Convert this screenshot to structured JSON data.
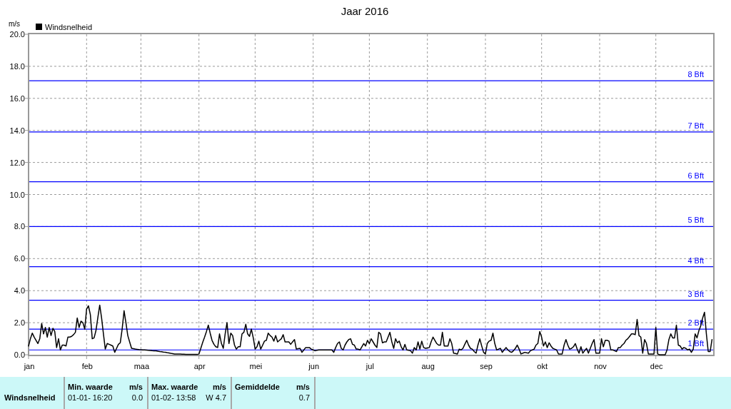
{
  "chart": {
    "chart_data": {
      "type": "line",
      "title": "Jaar 2016",
      "ylabel": "m/s",
      "grid": true,
      "categories": [
        "jan",
        null,
        null,
        null,
        null,
        null,
        null,
        null,
        null,
        null,
        null,
        null,
        null,
        null,
        null,
        null,
        null,
        null,
        null,
        null,
        null,
        null,
        null,
        null,
        null,
        null,
        null,
        null,
        null,
        null,
        null,
        "feb",
        null,
        null,
        null,
        null,
        null,
        null,
        null,
        null,
        null,
        null,
        null,
        null,
        null,
        null,
        null,
        null,
        null,
        null,
        null,
        null,
        null,
        null,
        null,
        null,
        null,
        null,
        null,
        null,
        "maa",
        null,
        null,
        null,
        null,
        null,
        null,
        null,
        null,
        null,
        null,
        null,
        null,
        null,
        null,
        null,
        null,
        null,
        null,
        null,
        null,
        null,
        null,
        null,
        null,
        null,
        null,
        null,
        null,
        null,
        null,
        "apr",
        null,
        null,
        null,
        null,
        null,
        null,
        null,
        null,
        null,
        null,
        null,
        null,
        null,
        null,
        null,
        null,
        null,
        null,
        null,
        null,
        null,
        null,
        null,
        null,
        null,
        null,
        null,
        null,
        null,
        "mei",
        null,
        null,
        null,
        null,
        null,
        null,
        null,
        null,
        null,
        null,
        null,
        null,
        null,
        null,
        null,
        null,
        null,
        null,
        null,
        null,
        null,
        null,
        null,
        null,
        null,
        null,
        null,
        null,
        null,
        null,
        "jun",
        null,
        null,
        null,
        null,
        null,
        null,
        null,
        null,
        null,
        null,
        null,
        null,
        null,
        null,
        null,
        null,
        null,
        null,
        null,
        null,
        null,
        null,
        null,
        null,
        null,
        null,
        null,
        null,
        null,
        "jul",
        null,
        null,
        null,
        null,
        null,
        null,
        null,
        null,
        null,
        null,
        null,
        null,
        null,
        null,
        null,
        null,
        null,
        null,
        null,
        null,
        null,
        null,
        null,
        null,
        null,
        null,
        null,
        null,
        null,
        null,
        "aug",
        null,
        null,
        null,
        null,
        null,
        null,
        null,
        null,
        null,
        null,
        null,
        null,
        null,
        null,
        null,
        null,
        null,
        null,
        null,
        null,
        null,
        null,
        null,
        null,
        null,
        null,
        null,
        null,
        null,
        null,
        "sep",
        null,
        null,
        null,
        null,
        null,
        null,
        null,
        null,
        null,
        null,
        null,
        null,
        null,
        null,
        null,
        null,
        null,
        null,
        null,
        null,
        null,
        null,
        null,
        null,
        null,
        null,
        null,
        null,
        null,
        "okt",
        null,
        null,
        null,
        null,
        null,
        null,
        null,
        null,
        null,
        null,
        null,
        null,
        null,
        null,
        null,
        null,
        null,
        null,
        null,
        null,
        null,
        null,
        null,
        null,
        null,
        null,
        null,
        null,
        null,
        null,
        "nov",
        null,
        null,
        null,
        null,
        null,
        null,
        null,
        null,
        null,
        null,
        null,
        null,
        null,
        null,
        null,
        null,
        null,
        null,
        null,
        null,
        null,
        null,
        null,
        null,
        null,
        null,
        null,
        null,
        null,
        "dec",
        null,
        null,
        null,
        null,
        null,
        null,
        null,
        null,
        null,
        null,
        null,
        null,
        null,
        null,
        null,
        null,
        null,
        null,
        null,
        null,
        null,
        null,
        null,
        null,
        null,
        null,
        null,
        null,
        null,
        null
      ],
      "series": [
        {
          "name": "Windsnelheid",
          "color": "#000000",
          "values": [
            0.55,
            1.0,
            1.35,
            1.1,
            0.9,
            0.7,
            1.0,
            1.95,
            1.3,
            1.7,
            1.1,
            1.7,
            1.2,
            1.65,
            1.45,
            0.45,
            1.0,
            0.3,
            0.6,
            0.6,
            0.55,
            1.1,
            1.1,
            1.15,
            1.25,
            1.4,
            2.3,
            1.7,
            2.1,
            2.0,
            1.6,
            2.85,
            3.05,
            2.5,
            1.0,
            1.05,
            1.5,
            2.3,
            3.1,
            2.3,
            1.3,
            0.35,
            0.7,
            0.65,
            0.6,
            0.55,
            0.15,
            0.4,
            0.65,
            0.75,
            1.6,
            2.75,
            2.0,
            1.2,
            0.8,
            0.4,
            0.38,
            0.35,
            0.34,
            0.32,
            0.31,
            0.3,
            0.3,
            0.29,
            0.28,
            0.27,
            0.26,
            0.25,
            0.24,
            0.22,
            0.2,
            0.19,
            0.17,
            0.15,
            0.13,
            0.11,
            0.09,
            0.07,
            0.05,
            0.05,
            0.04,
            0.04,
            0.03,
            0.03,
            0.02,
            0.02,
            0.02,
            0.02,
            0.02,
            0.02,
            0.02,
            0.05,
            0.4,
            0.77,
            1.1,
            1.45,
            1.85,
            1.35,
            0.9,
            0.65,
            0.5,
            0.45,
            1.3,
            0.7,
            0.4,
            1.3,
            2.0,
            0.7,
            1.35,
            1.2,
            0.6,
            0.35,
            0.5,
            0.5,
            1.3,
            1.4,
            1.9,
            1.3,
            1.15,
            1.6,
            1.05,
            0.35,
            0.5,
            0.85,
            0.35,
            0.6,
            0.85,
            0.9,
            1.35,
            1.2,
            1.1,
            0.85,
            1.2,
            0.8,
            0.9,
            1.0,
            1.25,
            0.8,
            0.8,
            0.8,
            0.65,
            0.8,
            0.95,
            0.35,
            0.38,
            0.4,
            0.15,
            0.3,
            0.45,
            0.45,
            0.45,
            0.35,
            0.3,
            0.25,
            0.28,
            0.3,
            0.3,
            0.3,
            0.3,
            0.3,
            0.3,
            0.3,
            0.3,
            0.15,
            0.45,
            0.7,
            0.8,
            0.4,
            0.3,
            0.6,
            0.8,
            0.95,
            1.0,
            0.65,
            0.6,
            0.35,
            0.35,
            0.3,
            0.5,
            0.7,
            0.55,
            0.9,
            0.7,
            1.0,
            0.8,
            0.6,
            0.45,
            1.4,
            1.3,
            0.75,
            0.8,
            0.8,
            1.1,
            1.4,
            0.8,
            0.4,
            1.0,
            0.75,
            0.85,
            0.5,
            0.3,
            0.65,
            0.3,
            0.28,
            0.25,
            0.1,
            0.45,
            0.3,
            0.8,
            0.35,
            0.85,
            0.45,
            0.4,
            0.42,
            0.45,
            0.8,
            1.1,
            0.9,
            0.7,
            0.6,
            0.6,
            1.4,
            0.55,
            0.55,
            0.55,
            1.0,
            0.7,
            0.1,
            0.08,
            0.05,
            0.35,
            0.3,
            0.4,
            0.65,
            0.9,
            0.6,
            0.4,
            0.35,
            0.2,
            0.1,
            0.6,
            1.0,
            0.55,
            0.15,
            0.05,
            0.7,
            0.85,
            0.9,
            1.35,
            0.7,
            0.3,
            0.35,
            0.4,
            0.15,
            0.3,
            0.45,
            0.3,
            0.2,
            0.15,
            0.25,
            0.4,
            0.6,
            0.35,
            0.05,
            0.1,
            0.15,
            0.12,
            0.1,
            0.25,
            0.3,
            0.35,
            0.6,
            0.7,
            1.45,
            1.1,
            0.55,
            0.8,
            0.45,
            0.75,
            0.55,
            0.4,
            0.35,
            0.3,
            0.05,
            0.05,
            0.05,
            0.6,
            0.95,
            0.6,
            0.35,
            0.4,
            0.5,
            0.7,
            0.35,
            0.1,
            0.5,
            0.1,
            0.25,
            0.4,
            0.1,
            0.4,
            0.7,
            0.95,
            0.1,
            0.1,
            0.1,
            1.0,
            0.5,
            0.9,
            0.9,
            0.85,
            0.3,
            0.3,
            0.25,
            0.2,
            0.45,
            0.45,
            0.6,
            0.7,
            0.9,
            1.0,
            1.15,
            1.3,
            1.3,
            1.25,
            2.2,
            1.2,
            1.1,
            0.1,
            0.95,
            0.7,
            0.05,
            0.05,
            0.05,
            0.05,
            1.7,
            0.05,
            0,
            0,
            0,
            0,
            0.3,
            0.95,
            1.3,
            1.05,
            1.05,
            1.85,
            0.6,
            0.55,
            0.35,
            0.45,
            0.4,
            0.3,
            0.35,
            0.15,
            0.35,
            1.3,
            1.05,
            1.5,
            1.8,
            2.3,
            2.65,
            1.3,
            0.2,
            0.2,
            0.95
          ]
        }
      ],
      "ylim": [
        0,
        20
      ],
      "yticks": [
        {
          "value": 0,
          "label": "0.0"
        },
        {
          "value": 2,
          "label": "2.0"
        },
        {
          "value": 4,
          "label": "4.0"
        },
        {
          "value": 6,
          "label": "6.0"
        },
        {
          "value": 8,
          "label": "8.0"
        },
        {
          "value": 10,
          "label": "10.0"
        },
        {
          "value": 12,
          "label": "12.0"
        },
        {
          "value": 14,
          "label": "14.0"
        },
        {
          "value": 16,
          "label": "16.0"
        },
        {
          "value": 18,
          "label": "18.0"
        },
        {
          "value": 20,
          "label": "20.0"
        }
      ],
      "ref_lines": [
        {
          "axis": "y",
          "value": 17.1,
          "label": "8 Bft"
        },
        {
          "axis": "y",
          "value": 13.9,
          "label": "7 Bft"
        },
        {
          "axis": "y",
          "value": 10.8,
          "label": "6 Bft"
        },
        {
          "axis": "y",
          "value": 8.0,
          "label": "5 Bft"
        },
        {
          "axis": "y",
          "value": 5.5,
          "label": "4 Bft"
        },
        {
          "axis": "y",
          "value": 3.4,
          "label": "3 Bft"
        },
        {
          "axis": "y",
          "value": 1.6,
          "label": "2 Bft"
        },
        {
          "axis": "y",
          "value": 0.3,
          "label": "1 Bft"
        }
      ]
    }
  },
  "summary_table": {
    "row_label": "Windsnelheid",
    "columns": [
      {
        "header": "Min. waarde",
        "unit": "m/s",
        "when": "01-01- 16:20",
        "value": "0.0"
      },
      {
        "header": "Max. waarde",
        "unit": "m/s",
        "when": "01-02- 13:58",
        "value": "W 4.7"
      },
      {
        "header": "Gemiddelde",
        "unit": "m/s",
        "value": "0.7"
      }
    ]
  }
}
